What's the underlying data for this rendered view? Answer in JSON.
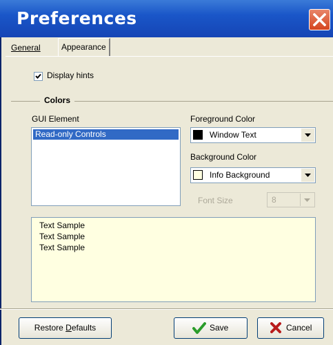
{
  "window": {
    "title": "Preferences"
  },
  "tabs": [
    {
      "label": "General",
      "selected": false
    },
    {
      "label": "Appearance",
      "selected": true
    }
  ],
  "appearance": {
    "display_hints": {
      "label": "Display hints",
      "checked": true
    },
    "colors_group": "Colors",
    "gui_element": {
      "label": "GUI Element",
      "items": [
        "Read-only Controls"
      ],
      "selected": "Read-only Controls"
    },
    "foreground": {
      "label": "Foreground Color",
      "value": "Window Text",
      "swatch": "#000000"
    },
    "background": {
      "label": "Background Color",
      "value": "Info Background",
      "swatch": "#ffffe1"
    },
    "font_size": {
      "label": "Font Size",
      "value": "8",
      "enabled": false
    },
    "sample_lines": [
      "Text Sample",
      "Text Sample",
      "Text Sample"
    ]
  },
  "buttons": {
    "restore_prefix": "Restore ",
    "restore_underline": "D",
    "restore_suffix": "efaults",
    "save": "Save",
    "cancel": "Cancel"
  },
  "colors": {
    "titlebar": "#1a56c8",
    "selection": "#316ac5",
    "sample_bg": "#ffffe1",
    "save_check": "#2a9c2a",
    "cancel_x": "#b81c1c"
  }
}
